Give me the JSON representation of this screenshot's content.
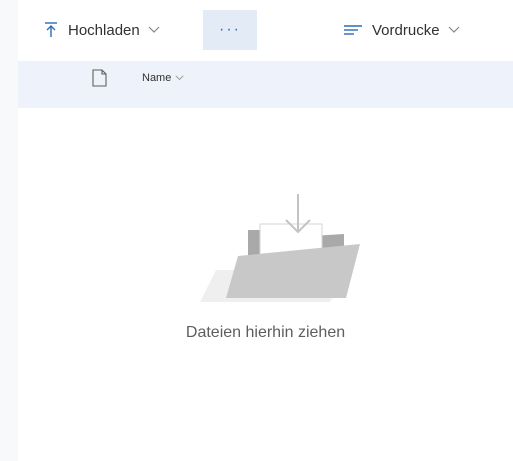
{
  "toolbar": {
    "upload_label": "Hochladen",
    "more_label": "···",
    "templates_label": "Vordrucke"
  },
  "list": {
    "column_name": "Name"
  },
  "empty_state": {
    "message": "Dateien hierhin ziehen"
  },
  "icons": {
    "upload": "upload-icon",
    "more": "more-options-icon",
    "templates": "templates-icon",
    "file_type": "file-icon",
    "sort": "chevron-down-icon"
  },
  "colors": {
    "accent": "#2b6cb8",
    "selected_bg": "#e3ebf7",
    "header_bg": "#eef3fb",
    "text": "#323130",
    "muted_text": "#605e5c"
  }
}
